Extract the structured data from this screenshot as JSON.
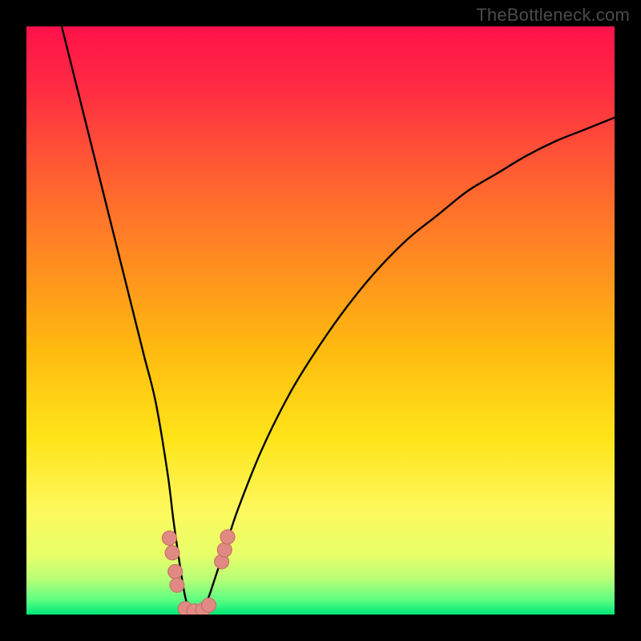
{
  "watermark": "TheBottleneck.com",
  "colors": {
    "frame": "#000000",
    "gradient_stops": [
      {
        "offset": 0.0,
        "color": "#ff124a"
      },
      {
        "offset": 0.1,
        "color": "#ff2a43"
      },
      {
        "offset": 0.25,
        "color": "#ff5e32"
      },
      {
        "offset": 0.4,
        "color": "#ff8c20"
      },
      {
        "offset": 0.55,
        "color": "#ffbb10"
      },
      {
        "offset": 0.7,
        "color": "#ffe419"
      },
      {
        "offset": 0.82,
        "color": "#fdf85c"
      },
      {
        "offset": 0.9,
        "color": "#e8ff6a"
      },
      {
        "offset": 0.94,
        "color": "#b7ff77"
      },
      {
        "offset": 0.975,
        "color": "#5dff82"
      },
      {
        "offset": 1.0,
        "color": "#00e676"
      }
    ],
    "curve": "#000000",
    "marker_fill": "#e08a83",
    "marker_stroke": "#c46a63"
  },
  "chart_data": {
    "type": "line",
    "title": "",
    "xlabel": "",
    "ylabel": "",
    "xlim": [
      0,
      100
    ],
    "ylim": [
      0,
      100
    ],
    "grid": false,
    "legend": false,
    "series": [
      {
        "name": "bottleneck-curve",
        "x": [
          6,
          8,
          10,
          12,
          14,
          16,
          18,
          20,
          22,
          24,
          25,
          26,
          27,
          28,
          29,
          30,
          31,
          32,
          34,
          36,
          40,
          45,
          50,
          55,
          60,
          65,
          70,
          75,
          80,
          85,
          90,
          95,
          100
        ],
        "y": [
          100,
          92,
          84,
          76,
          68,
          60,
          52,
          44,
          36,
          24,
          16,
          9,
          3,
          0.5,
          0.5,
          0.8,
          3,
          6,
          12,
          18,
          28,
          38,
          46,
          53,
          59,
          64,
          68,
          72,
          75,
          78,
          80.5,
          82.5,
          84.5
        ]
      }
    ],
    "markers": [
      {
        "x": 24.3,
        "y": 13.0
      },
      {
        "x": 24.8,
        "y": 10.5
      },
      {
        "x": 25.3,
        "y": 7.3
      },
      {
        "x": 25.6,
        "y": 5.0
      },
      {
        "x": 27.0,
        "y": 1.0
      },
      {
        "x": 28.5,
        "y": 0.6
      },
      {
        "x": 30.0,
        "y": 0.8
      },
      {
        "x": 31.0,
        "y": 1.6
      },
      {
        "x": 33.2,
        "y": 9.0
      },
      {
        "x": 33.7,
        "y": 11.0
      },
      {
        "x": 34.2,
        "y": 13.2
      }
    ]
  }
}
